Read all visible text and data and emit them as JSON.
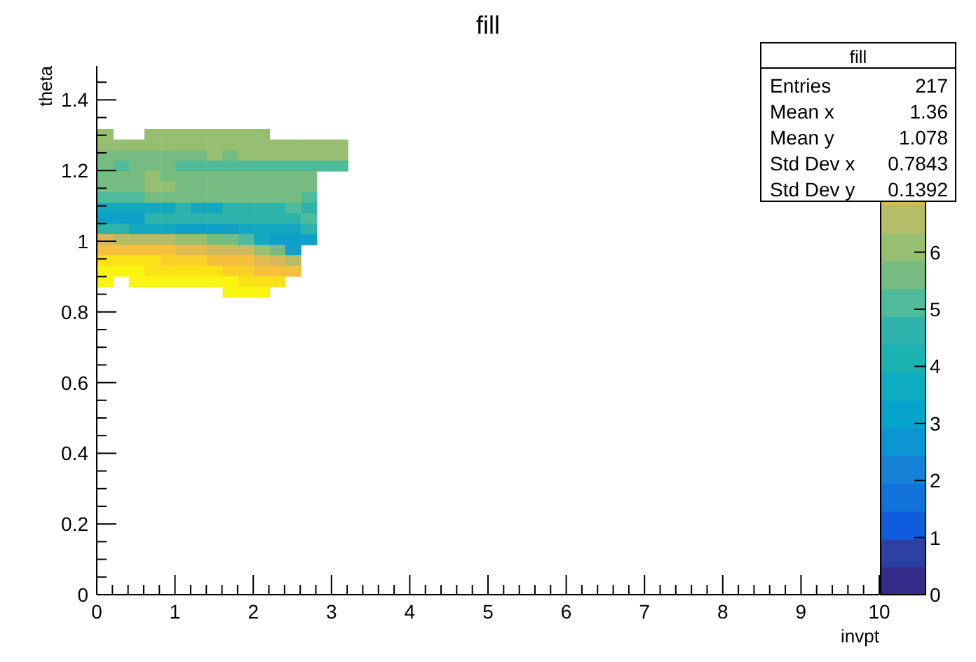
{
  "title": "fill",
  "x_axis": {
    "title": "invpt",
    "tick_labels": [
      "0",
      "1",
      "2",
      "3",
      "4",
      "5",
      "6",
      "7",
      "8",
      "9",
      "10"
    ]
  },
  "y_axis": {
    "title": "theta",
    "tick_labels": [
      "1.4",
      "1.2",
      "1",
      "0.8",
      "0.6",
      "0.4",
      "0.2",
      "0"
    ]
  },
  "color_scale": {
    "tick_labels": [
      "6",
      "5",
      "4",
      "3",
      "2",
      "1",
      "0"
    ]
  },
  "stats_box": {
    "title": "fill",
    "rows": [
      {
        "label": "Entries",
        "value": "217"
      },
      {
        "label": "Mean x",
        "value": "1.36"
      },
      {
        "label": "Mean y",
        "value": "1.078"
      },
      {
        "label": "Std Dev x",
        "value": "0.7843"
      },
      {
        "label": "Std Dev y",
        "value": "0.1392"
      }
    ]
  }
}
